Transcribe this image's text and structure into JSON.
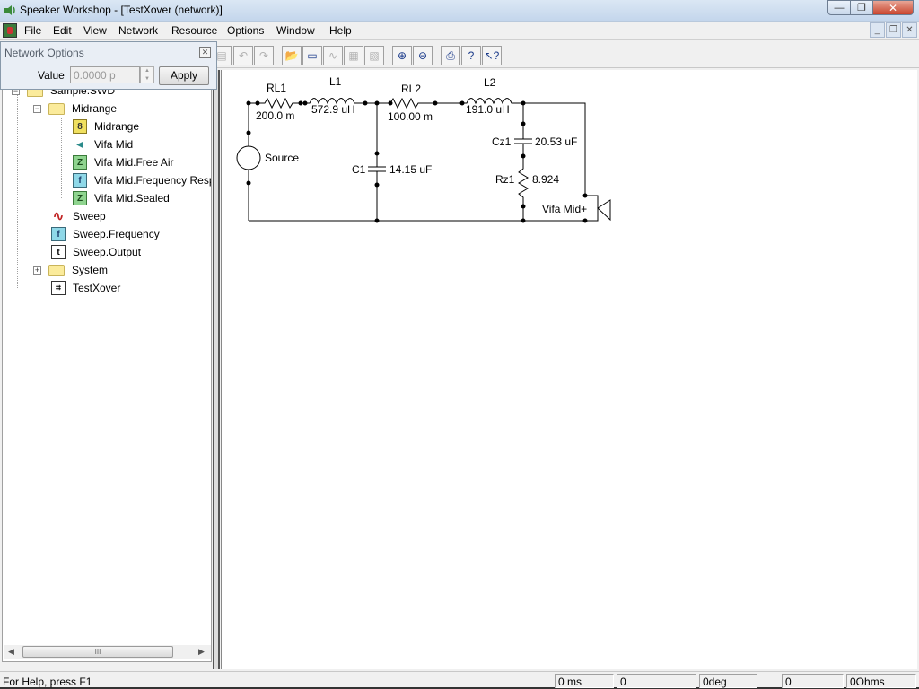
{
  "window": {
    "title": "Speaker Workshop - [TestXover (network)]",
    "minimize": "—",
    "maximize": "❐",
    "close": "✕"
  },
  "menu": {
    "items": [
      "File",
      "Edit",
      "View",
      "Network",
      "Resource",
      "Options",
      "Window",
      "Help"
    ],
    "mdi_minimize": "_",
    "mdi_restore": "❐",
    "mdi_close": "✕"
  },
  "toolbar": {
    "buttons": [
      {
        "name": "paste",
        "glyph": "▤",
        "state": "disabled"
      },
      {
        "name": "undo",
        "glyph": "↶",
        "state": "disabled"
      },
      {
        "name": "redo",
        "glyph": "↷",
        "state": "disabled"
      },
      {
        "name": "open",
        "glyph": "📂",
        "state": "disabled"
      },
      {
        "name": "properties",
        "glyph": "▭",
        "state": "active"
      },
      {
        "name": "chart",
        "glyph": "∿",
        "state": "disabled"
      },
      {
        "name": "calculate",
        "glyph": "▦",
        "state": "disabled"
      },
      {
        "name": "merge",
        "glyph": "▧",
        "state": "disabled"
      },
      {
        "name": "zoom-in",
        "glyph": "⊕",
        "state": "active"
      },
      {
        "name": "zoom-out",
        "glyph": "⊖",
        "state": "active"
      },
      {
        "name": "print",
        "glyph": "⎙",
        "state": "active"
      },
      {
        "name": "help",
        "glyph": "?",
        "state": "active"
      },
      {
        "name": "context-help",
        "glyph": "↖?",
        "state": "active"
      }
    ]
  },
  "network_options": {
    "title": "Network Options",
    "close": "✕",
    "value_label": "Value",
    "value": "0.0000 p",
    "spin_up": "▲",
    "spin_down": "▼",
    "apply": "Apply"
  },
  "tree": {
    "root": "Sample.SWD",
    "items": [
      {
        "label": "Midrange",
        "type": "folder",
        "expander": "−"
      },
      {
        "label": "Midrange",
        "type": "enclosure",
        "glyph": "8"
      },
      {
        "label": "Vifa Mid",
        "type": "driver",
        "glyph": "◀"
      },
      {
        "label": "Vifa Mid.Free Air",
        "type": "impedance",
        "glyph": "Z"
      },
      {
        "label": "Vifa Mid.Frequency Resp",
        "type": "frequency",
        "glyph": "f"
      },
      {
        "label": "Vifa Mid.Sealed",
        "type": "impedance",
        "glyph": "Z"
      },
      {
        "label": "Sweep",
        "type": "signal",
        "glyph": "∿"
      },
      {
        "label": "Sweep.Frequency",
        "type": "frequency",
        "glyph": "f"
      },
      {
        "label": "Sweep.Output",
        "type": "time",
        "glyph": "t"
      },
      {
        "label": "System",
        "type": "folder",
        "expander": "+"
      },
      {
        "label": "TestXover",
        "type": "network",
        "glyph": "⌗"
      }
    ],
    "scroll_thumb": "III",
    "scroll_left": "◀",
    "scroll_right": "▶"
  },
  "circuit": {
    "components": [
      {
        "id": "RL1",
        "value": "200.0 m",
        "kind": "resistor"
      },
      {
        "id": "L1",
        "value": "572.9 uH",
        "kind": "inductor"
      },
      {
        "id": "RL2",
        "value": "100.00 m",
        "kind": "resistor"
      },
      {
        "id": "L2",
        "value": "191.0 uH",
        "kind": "inductor"
      },
      {
        "id": "C1",
        "value": "14.15 uF",
        "kind": "capacitor"
      },
      {
        "id": "Cz1",
        "value": "20.53 uF",
        "kind": "capacitor"
      },
      {
        "id": "Rz1",
        "value": "8.924",
        "kind": "resistor"
      },
      {
        "id": "Source",
        "value": "",
        "kind": "source"
      },
      {
        "id": "Vifa Mid+",
        "value": "",
        "kind": "speaker"
      }
    ]
  },
  "status": {
    "help": "For Help, press F1",
    "cells": [
      "0 ms",
      "0",
      "0deg",
      "0",
      "0Ohms"
    ]
  }
}
